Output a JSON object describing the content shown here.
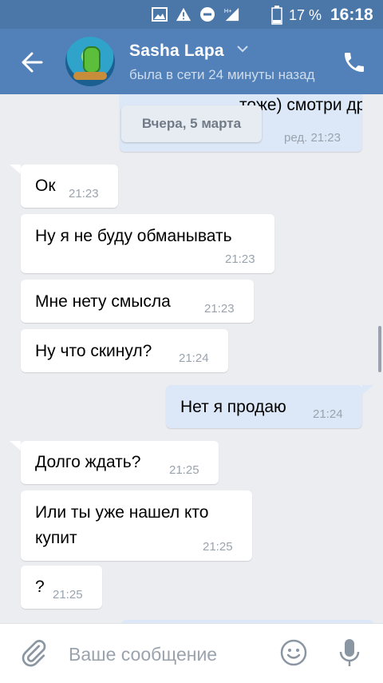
{
  "status_bar": {
    "battery": "17 %",
    "time": "16:18"
  },
  "header": {
    "name": "Sasha Lapa",
    "status": "была в сети 24 минуты назад"
  },
  "partial_message": {
    "text": "тоже) смотри друзья",
    "time": "ред. 21:23"
  },
  "date_divider": "Вчера, 5 марта",
  "messages": [
    {
      "text": "Ок",
      "time": "21:23"
    },
    {
      "text": "Ну я не буду обманывать",
      "time": "21:23"
    },
    {
      "text": "Мне нету смысла",
      "time": "21:23"
    },
    {
      "text": "Ну что скинул?",
      "time": "21:24"
    },
    {
      "text": "Нет я продаю",
      "time": "21:24"
    },
    {
      "text": "Долго ждать?",
      "time": "21:25"
    },
    {
      "text_line1": "Или ты уже нашел кто",
      "text_line2": "купит",
      "time": "21:25"
    },
    {
      "text": "?",
      "time": "21:25"
    }
  ],
  "composer": {
    "placeholder": "Ваше сообщение"
  },
  "colors": {
    "header": "#5181b8",
    "status_bar": "#4a76a8",
    "outgoing_bubble": "#dce8f7",
    "background": "#ebedf0"
  }
}
